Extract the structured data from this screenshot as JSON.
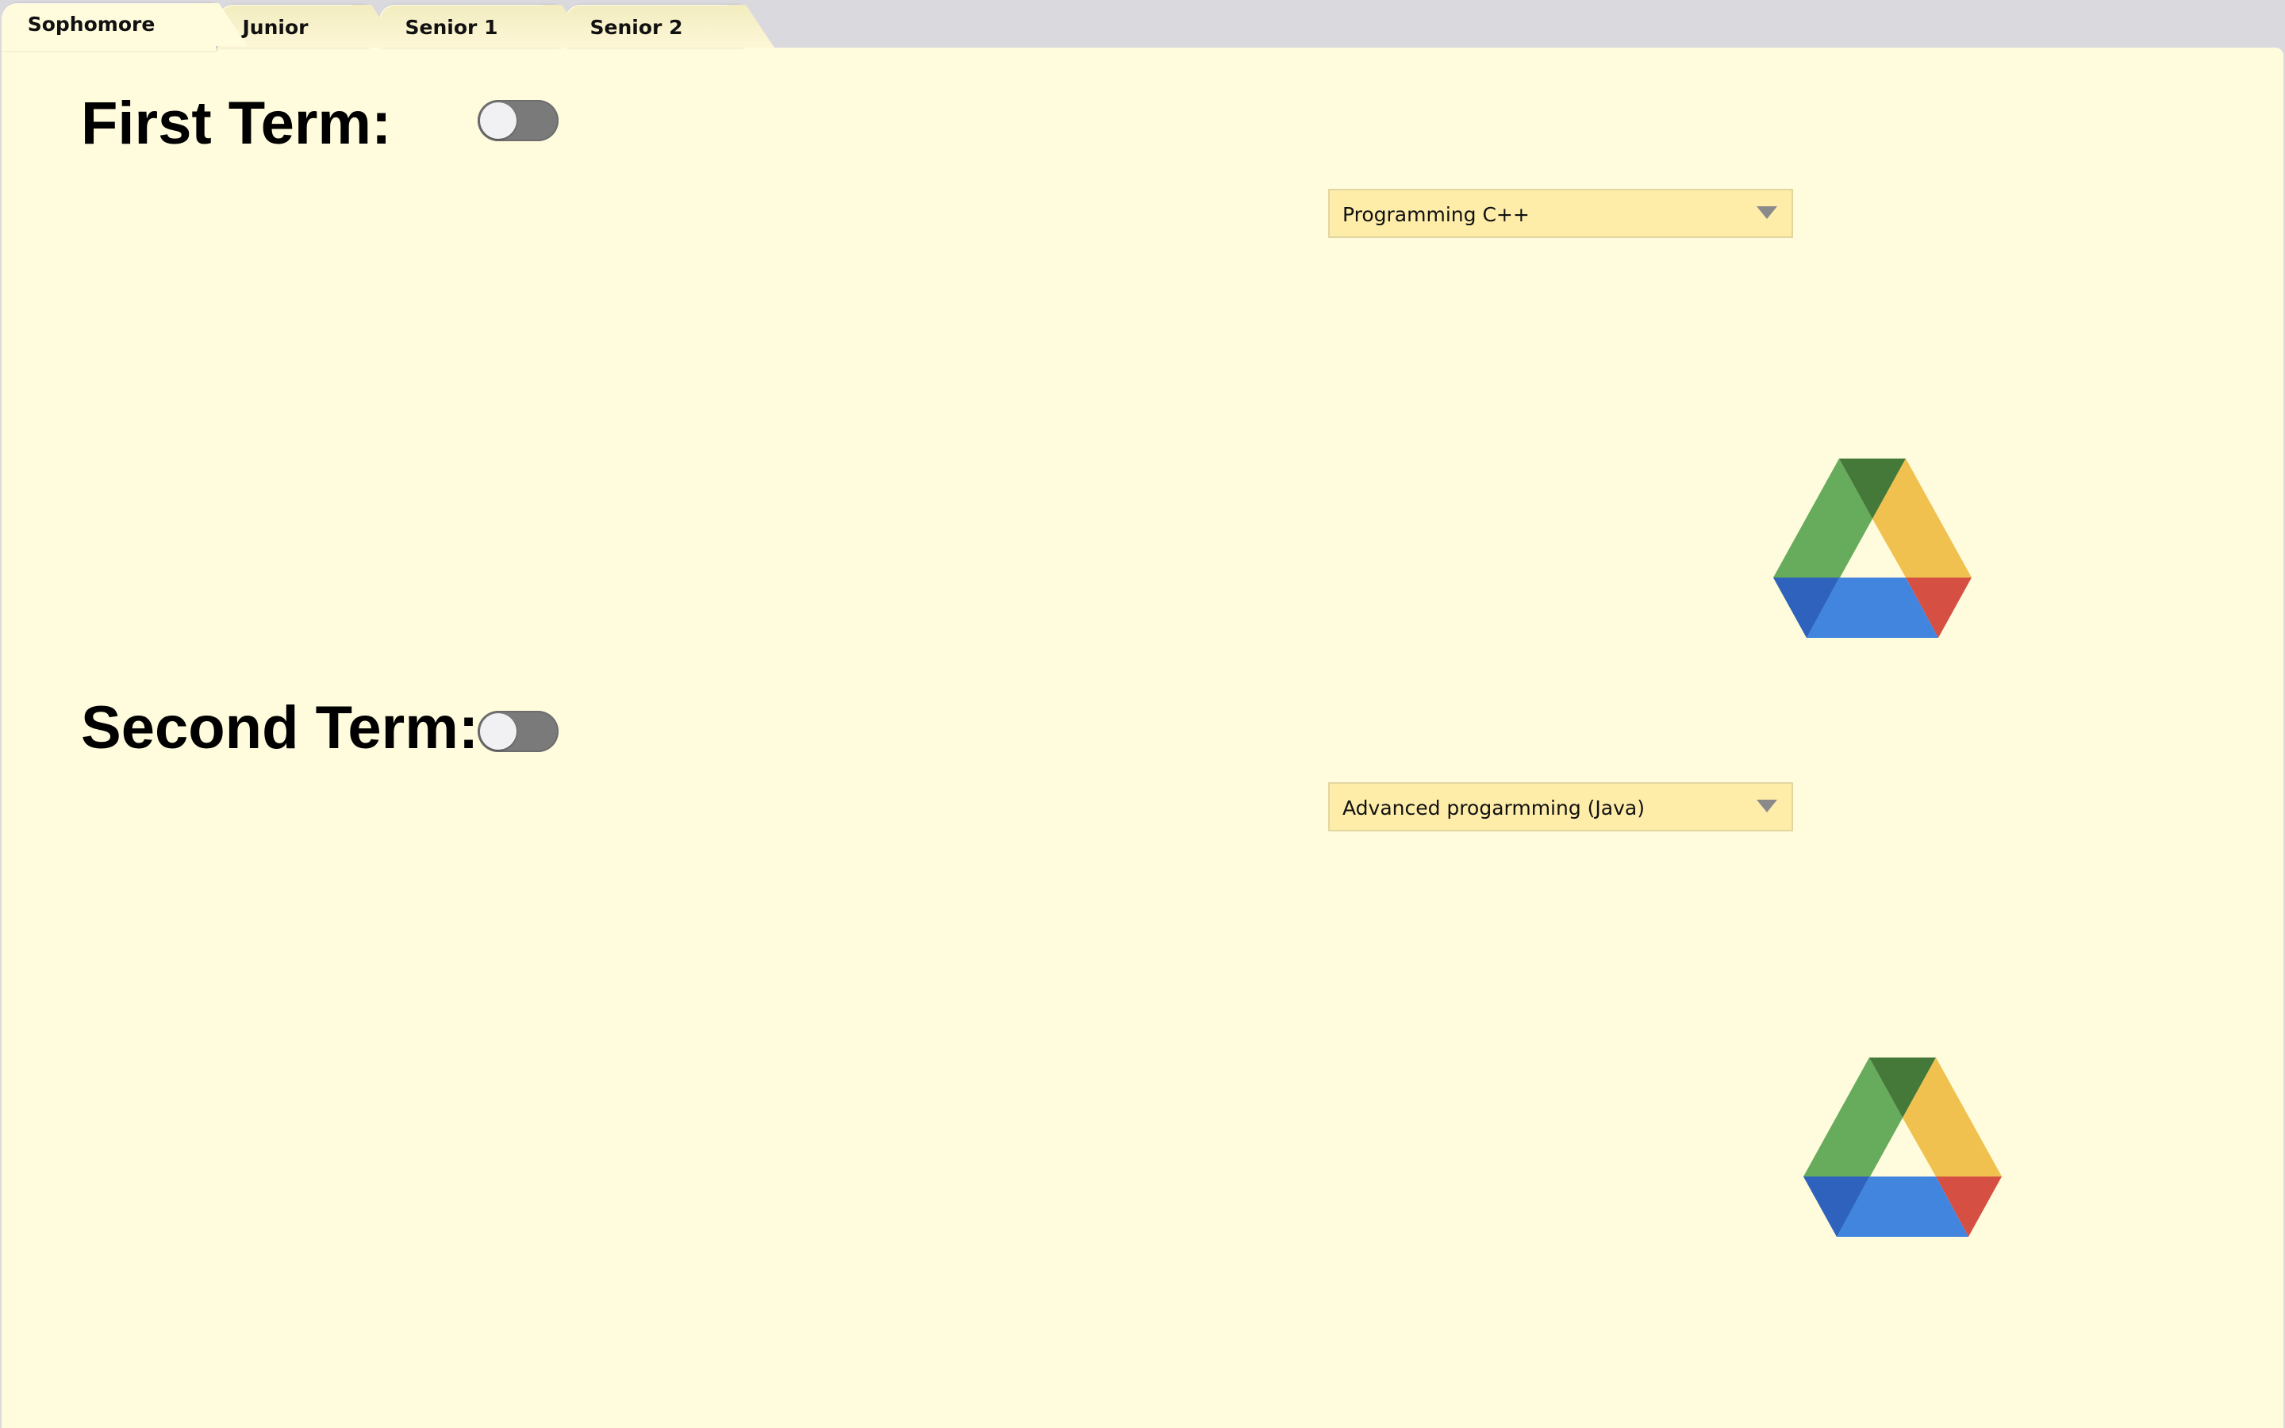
{
  "tabs": [
    {
      "label": "Sophomore",
      "active": true
    },
    {
      "label": "Junior",
      "active": false
    },
    {
      "label": "Senior 1",
      "active": false
    },
    {
      "label": "Senior 2",
      "active": false
    }
  ],
  "first_term": {
    "title": "First Term:",
    "toggle_on": false,
    "course_select": {
      "value": "Programming C++"
    },
    "link_icon": "google-drive-icon"
  },
  "second_term": {
    "title": "Second Term:",
    "toggle_on": false,
    "course_select": {
      "value": "Advanced progarmming (Java)"
    },
    "link_icon": "google-drive-icon"
  },
  "colors": {
    "panel_background": "#fffbdd",
    "tab_strip_background": "#d9d9de",
    "dropdown_background": "#feeca9",
    "toggle_off": "#7a7a7a",
    "drive_green": "#67ac5c",
    "drive_dark_green": "#45793a",
    "drive_yellow": "#f0c14e",
    "drive_blue": "#4285de",
    "drive_dark_blue": "#2f62bd",
    "drive_red": "#d64f43"
  }
}
